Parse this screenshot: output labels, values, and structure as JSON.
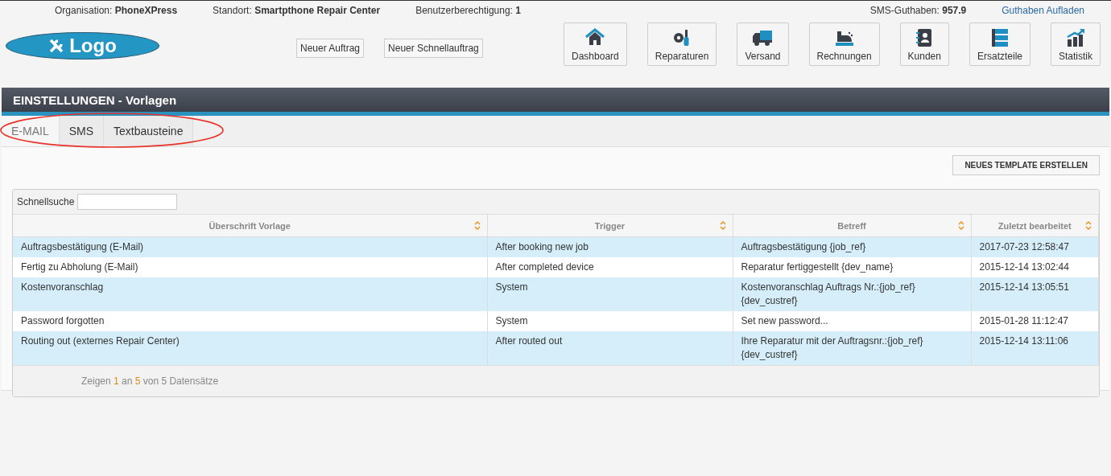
{
  "top_bar": {
    "organisation": {
      "label": "Organisation:",
      "value": "PhoneXPress"
    },
    "standort": {
      "label": "Standort:",
      "value": "Smartpthone Repair Center"
    },
    "berechtigung": {
      "label": "Benutzerberechtigung:",
      "value": "1"
    },
    "sms": {
      "label": "SMS-Guthaben:",
      "value": "957.9"
    },
    "link": "Guthaben Aufladen"
  },
  "logo": "Logo",
  "quick_buttons": [
    "Neuer Auftrag",
    "Neuer Schnellauftrag"
  ],
  "nav": [
    {
      "label": "Dashboard",
      "kind": "home"
    },
    {
      "label": "Reparaturen",
      "kind": "tools"
    },
    {
      "label": "Versand",
      "kind": "truck"
    },
    {
      "label": "Rechnungen",
      "kind": "register"
    },
    {
      "label": "Kunden",
      "kind": "contacts"
    },
    {
      "label": "Ersatzteile",
      "kind": "server"
    },
    {
      "label": "Statistik",
      "kind": "chart"
    }
  ],
  "page_title": "EINSTELLUNGEN - Vorlagen",
  "tabs": [
    {
      "label": "E-MAIL",
      "selected": true
    },
    {
      "label": "SMS",
      "selected": false
    },
    {
      "label": "Textbausteine",
      "selected": false
    }
  ],
  "create_button": "NEUES TEMPLATE ERSTELLEN",
  "search": {
    "label": "Schnellsuche"
  },
  "table": {
    "columns": [
      "Überschrift Vorlage",
      "Trigger",
      "Betreff",
      "Zuletzt bearbeitet"
    ],
    "rows": [
      [
        "Auftragsbestätigung (E-Mail)",
        "After booking new job",
        "Auftragsbestätigung {job_ref}",
        "2017-07-23 12:58:47"
      ],
      [
        "Fertig zu Abholung (E-Mail)",
        "After completed device",
        "Reparatur fertiggestellt {dev_name}",
        "2015-12-14 13:02:44"
      ],
      [
        "Kostenvoranschlag",
        "System",
        "Kostenvoranschlag Auftrags Nr.:{job_ref} {dev_custref}",
        "2015-12-14 13:05:51"
      ],
      [
        "Password forgotten",
        "System",
        "Set new password...",
        "2015-01-28 11:12:47"
      ],
      [
        "Routing out (externes Repair Center)",
        "After routed out",
        "Ihre Reparatur mit der Auftragsnr.:{job_ref} {dev_custref}",
        "2015-12-14 13:11:06"
      ]
    ]
  },
  "footer": [
    {
      "text": "Zeigen ",
      "highlight": false
    },
    {
      "text": "1",
      "highlight": true
    },
    {
      "text": " an ",
      "highlight": false
    },
    {
      "text": "5",
      "highlight": true
    },
    {
      "text": " von 5 Datensätze",
      "highlight": false
    }
  ]
}
